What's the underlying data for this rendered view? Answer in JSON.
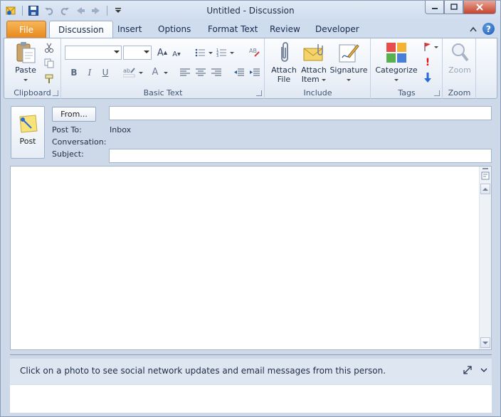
{
  "window": {
    "title": "Untitled  -  Discussion"
  },
  "quick_access": {
    "icons": [
      "outlook-icon",
      "save-icon",
      "undo-icon",
      "redo-icon",
      "previous-item-icon",
      "next-item-icon",
      "customize-toolbar-icon"
    ]
  },
  "tabs": [
    {
      "label": "File"
    },
    {
      "label": "Discussion"
    },
    {
      "label": "Insert"
    },
    {
      "label": "Options"
    },
    {
      "label": "Format Text"
    },
    {
      "label": "Review"
    },
    {
      "label": "Developer"
    }
  ],
  "ribbon": {
    "clipboard": {
      "label": "Clipboard",
      "paste": "Paste"
    },
    "basic_text": {
      "label": "Basic Text",
      "font_name": "",
      "font_size": "",
      "bold": "B",
      "italic": "I",
      "underline": "U",
      "grow": "A",
      "shrink": "A",
      "font_color": "A"
    },
    "include": {
      "label": "Include",
      "attach_file_line1": "Attach",
      "attach_file_line2": "File",
      "attach_item_line1": "Attach",
      "attach_item_line2": "Item",
      "signature": "Signature"
    },
    "tags": {
      "label": "Tags",
      "categorize": "Categorize"
    },
    "zoom": {
      "label": "Zoom",
      "zoom": "Zoom"
    }
  },
  "header": {
    "post_button": "Post",
    "from_button": "From...",
    "from_value": "",
    "post_to_label": "Post To:",
    "post_to_value": "Inbox",
    "conversation_label": "Conversation:",
    "subject_label": "Subject:",
    "subject_value": ""
  },
  "people_pane": {
    "message": "Click on a photo to see social network updates and email messages from this person."
  },
  "colors": {
    "file_tab": "#e7881c",
    "window_frame": "#cdd9e8",
    "close_button": "#c7432b"
  }
}
